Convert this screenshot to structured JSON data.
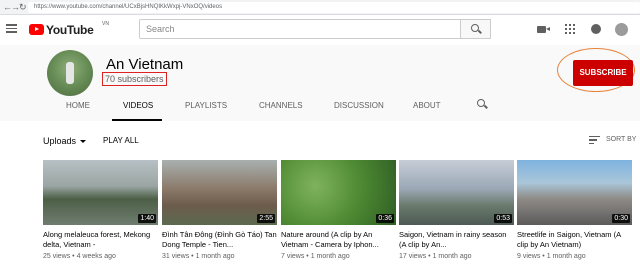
{
  "browser": {
    "url": "https://www.youtube.com/channel/UCxBjsHNQIKkWxpj-VNxOQ/videos"
  },
  "masthead": {
    "logo_text": "YouTube",
    "logo_country": "VN",
    "search_placeholder": "Search"
  },
  "channel": {
    "name": "An Vietnam",
    "subscribers": "70 subscribers",
    "subscribe_label": "SUBSCRIBE"
  },
  "tabs": [
    {
      "label": "HOME",
      "active": false
    },
    {
      "label": "VIDEOS",
      "active": true
    },
    {
      "label": "PLAYLISTS",
      "active": false
    },
    {
      "label": "CHANNELS",
      "active": false
    },
    {
      "label": "DISCUSSION",
      "active": false
    },
    {
      "label": "ABOUT",
      "active": false
    }
  ],
  "filters": {
    "uploads_label": "Uploads",
    "play_all_label": "PLAY ALL",
    "sort_label": "SORT BY"
  },
  "videos": [
    {
      "title": "Along melaleuca forest, Mekong delta, Vietnam -",
      "duration": "1:40",
      "views": "25 views",
      "age": "4 weeks ago"
    },
    {
      "title": "Đình Tân Đông (Đình Gò Táo) Tan Dong Temple - Tien...",
      "duration": "2:55",
      "views": "31 views",
      "age": "1 month ago"
    },
    {
      "title": "Nature around (A clip by An Vietnam - Camera by Iphon...",
      "duration": "0:36",
      "views": "7 views",
      "age": "1 month ago"
    },
    {
      "title": "Saigon, Vietnam in rainy season (A clip by An...",
      "duration": "0:53",
      "views": "17 views",
      "age": "1 month ago"
    },
    {
      "title": "Streetlife in Saigon, Vietnam (A clip by An Vietnam)",
      "duration": "0:30",
      "views": "9 views",
      "age": "1 month ago"
    }
  ],
  "colors": {
    "brand_red": "#ff0000",
    "subscribe_red": "#cc0000",
    "highlight_box": "#dd2222",
    "highlight_ring": "#e8823a"
  }
}
